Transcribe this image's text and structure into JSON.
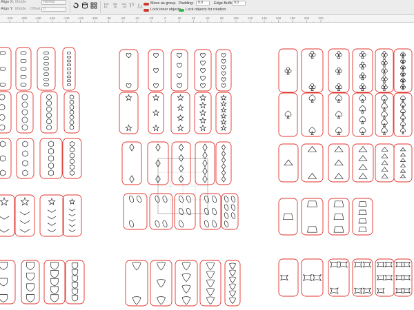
{
  "toolbar": {
    "align_x_label": "Align X:",
    "align_x_value": "Middle",
    "blend_value": "Normal",
    "align_y_label": "Align Y:",
    "align_y_value": "Middle",
    "offset_label": "Offset",
    "offset_value": "0",
    "move_as_group_label": "Move as group",
    "lock_inner_label": "Lock inner objects",
    "lock_rotation_label": "Lock objects for rotation",
    "padding_label": "Padding:",
    "padding_value": "0.0",
    "edge_buffer_label": "Edge Buffer:",
    "edge_buffer_value": "0.0",
    "colors": {
      "toggle_red": "#d0372f",
      "toggle_green": "#37b44a"
    }
  },
  "ruler": {
    "labels": [
      "-220",
      "-200",
      "-180",
      "-160",
      "-140",
      "-120",
      "-100",
      "-80",
      "-60",
      "-40",
      "-20",
      "0",
      "20",
      "40",
      "60",
      "80",
      "100",
      "120",
      "140",
      "160",
      "180",
      "200",
      "220"
    ]
  },
  "canvas": {
    "outline_color": "#e0302a",
    "shape_color": "#222222",
    "groups": [
      {
        "symbol": "oval",
        "counts": [
          3,
          5,
          7,
          9
        ]
      },
      {
        "symbol": "circle",
        "counts": [
          4,
          5,
          6,
          7
        ]
      },
      {
        "symbol": "hexagon",
        "counts": [
          3,
          4,
          5,
          6
        ]
      },
      {
        "symbol": "chevron-star",
        "counts": [
          3,
          4,
          5,
          6
        ]
      },
      {
        "symbol": "shield",
        "counts": [
          3,
          4,
          5,
          6
        ]
      },
      {
        "symbol": "heart",
        "counts": [
          2,
          3,
          4,
          5,
          6
        ]
      },
      {
        "symbol": "star",
        "counts": [
          2,
          3,
          4,
          5,
          6
        ]
      },
      {
        "symbol": "diamond",
        "counts": [
          2,
          3,
          4,
          5,
          6
        ]
      },
      {
        "symbol": "bean",
        "counts": [
          3,
          4,
          5,
          6,
          7
        ]
      },
      {
        "symbol": "guitar-pick",
        "counts": [
          2,
          3,
          4,
          5,
          6
        ]
      },
      {
        "symbol": "club",
        "counts": [
          1,
          2,
          3,
          4,
          5,
          6
        ]
      },
      {
        "symbol": "spade",
        "counts": [
          1,
          2,
          3,
          4,
          5,
          6
        ]
      },
      {
        "symbol": "triangle",
        "counts": [
          1,
          2,
          3,
          4,
          5,
          6
        ]
      },
      {
        "symbol": "trapezoid",
        "counts": [
          1,
          2,
          3,
          4
        ]
      },
      {
        "symbol": "x-shape",
        "counts": [
          1,
          2,
          3,
          4,
          5,
          6
        ]
      }
    ]
  }
}
